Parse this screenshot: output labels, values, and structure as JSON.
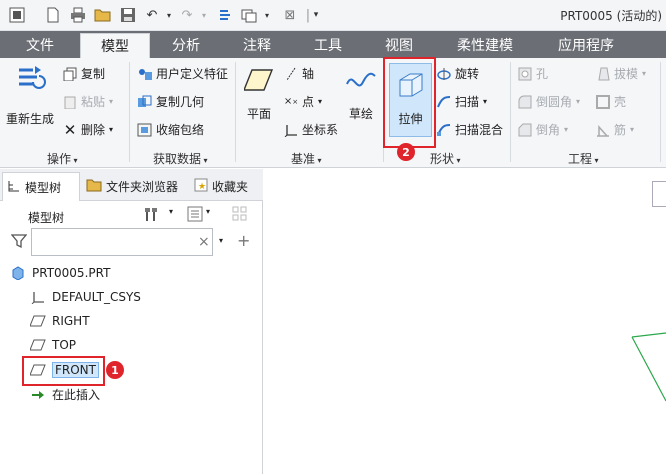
{
  "window": {
    "title": "PRT0005 (活动的)"
  },
  "tabs": [
    {
      "label": "文件",
      "active": false
    },
    {
      "label": "模型",
      "active": true
    },
    {
      "label": "分析",
      "active": false
    },
    {
      "label": "注释",
      "active": false
    },
    {
      "label": "工具",
      "active": false
    },
    {
      "label": "视图",
      "active": false
    },
    {
      "label": "柔性建模",
      "active": false
    },
    {
      "label": "应用程序",
      "active": false
    }
  ],
  "ribbon": {
    "operations": {
      "label": "操作",
      "regenerate": "重新生成",
      "copy": "复制",
      "paste": "粘贴",
      "delete": "删除"
    },
    "get_data": {
      "label": "获取数据",
      "udf": "用户定义特征",
      "copy_geometry": "复制几何",
      "shrinkwrap": "收缩包络"
    },
    "datum": {
      "label": "基准",
      "plane": "平面",
      "axis": "轴",
      "point": "点",
      "csys": "坐标系",
      "sketch": "草绘"
    },
    "shapes": {
      "label": "形状",
      "extrude": "拉伸",
      "revolve": "旋转",
      "sweep": "扫描",
      "swept_blend": "扫描混合"
    },
    "engineering": {
      "label": "工程",
      "hole": "孔",
      "draft": "拔模",
      "round": "倒圆角",
      "shell": "壳",
      "chamfer": "倒角",
      "rib": "筋"
    }
  },
  "panel": {
    "tabs": [
      "模型树",
      "文件夹浏览器",
      "收藏夹"
    ],
    "tree_label": "模型树",
    "filter_placeholder": "",
    "items": [
      {
        "label": "PRT0005.PRT",
        "icon": "part-icon"
      },
      {
        "label": "DEFAULT_CSYS",
        "icon": "csys-icon"
      },
      {
        "label": "RIGHT",
        "icon": "datum-plane-icon"
      },
      {
        "label": "TOP",
        "icon": "datum-plane-icon"
      },
      {
        "label": "FRONT",
        "icon": "datum-plane-icon",
        "selected": true
      },
      {
        "label": "在此插入",
        "icon": "insert-here-arrow-icon"
      }
    ]
  },
  "annotations": {
    "step1": "1",
    "step2": "2"
  },
  "colors": {
    "highlight": "#e0242b",
    "selection": "#cfe6fb",
    "tab_bar": "#6b6f75"
  }
}
